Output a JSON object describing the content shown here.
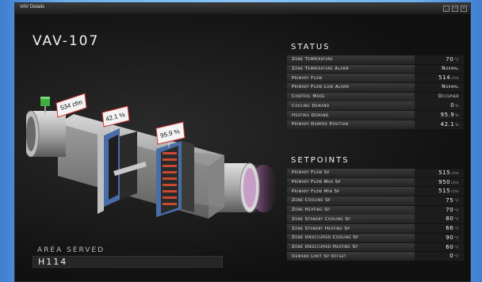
{
  "window": {
    "title": "VAV Details",
    "controls": [
      "_",
      "□",
      "×"
    ]
  },
  "unit": {
    "name": "VAV-107"
  },
  "callouts": {
    "flow": "534 cfm",
    "damper": "42.1 %",
    "heating": "95.9 %"
  },
  "area_served": {
    "label": "AREA SERVED",
    "value": "H114"
  },
  "status": {
    "title": "STATUS",
    "rows": [
      {
        "label": "Zone Temperature",
        "value": "70",
        "unit": "°F"
      },
      {
        "label": "Zone Temperature Alarm",
        "value": "Normal",
        "unit": ""
      },
      {
        "label": "Primary Flow",
        "value": "514",
        "unit": "cfm"
      },
      {
        "label": "Primary Flow Low Alarm",
        "value": "Normal",
        "unit": ""
      },
      {
        "label": "Control Mode",
        "value": "Occupied",
        "unit": ""
      },
      {
        "label": "Cooling Demand",
        "value": "0",
        "unit": "%"
      },
      {
        "label": "Heating Demand",
        "value": "95.9",
        "unit": "%"
      },
      {
        "label": "Primary Damper Position",
        "value": "42.1",
        "unit": "%"
      }
    ]
  },
  "setpoints": {
    "title": "SETPOINTS",
    "rows": [
      {
        "label": "Primary Flow Sp",
        "value": "515",
        "unit": "cfm"
      },
      {
        "label": "Primary Flow Max Sp",
        "value": "950",
        "unit": "cfm"
      },
      {
        "label": "Primary Flow Min Sp",
        "value": "515",
        "unit": "cfm"
      },
      {
        "label": "Zone Cooling Sp",
        "value": "75",
        "unit": "°F"
      },
      {
        "label": "Zone Heating Sp",
        "value": "70",
        "unit": "°F"
      },
      {
        "label": "Zone Standby Cooling Sp",
        "value": "80",
        "unit": "°F"
      },
      {
        "label": "Zone Standby Heating Sp",
        "value": "66",
        "unit": "°F"
      },
      {
        "label": "Zone Unoccupied Cooling Sp",
        "value": "90",
        "unit": "°F"
      },
      {
        "label": "Zone Unoccupied Heating Sp",
        "value": "60",
        "unit": "°F"
      },
      {
        "label": "Demand Limit Sp Offset",
        "value": "0",
        "unit": "°F"
      }
    ]
  }
}
